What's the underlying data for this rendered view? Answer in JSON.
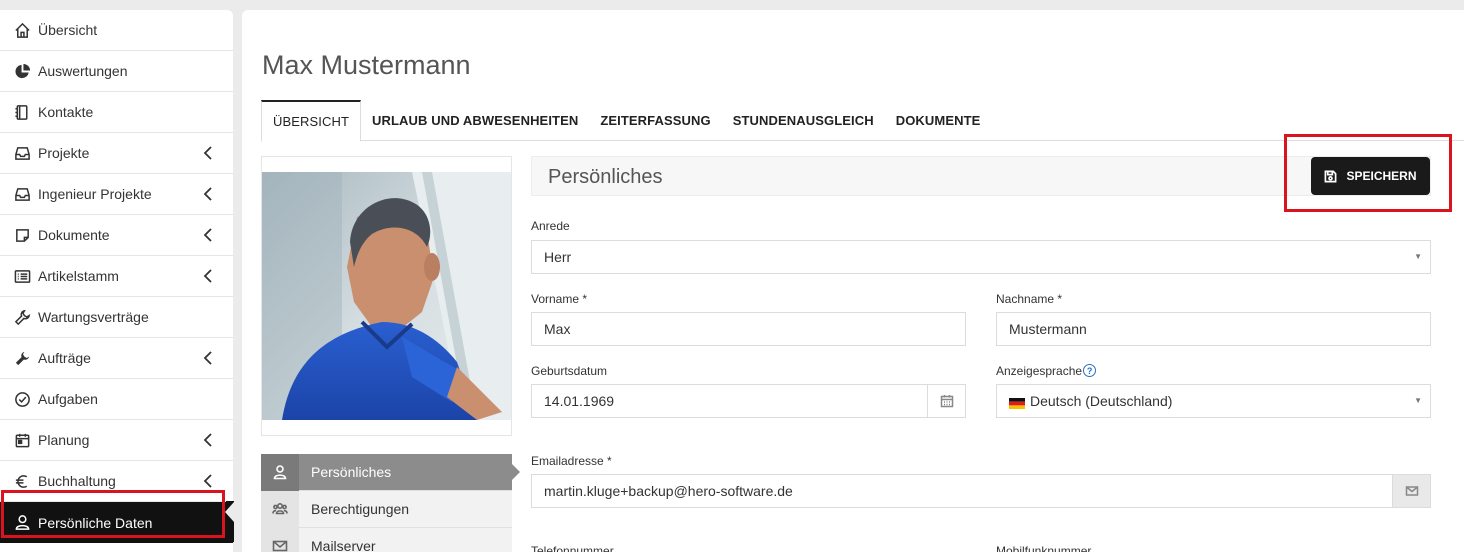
{
  "sidebar": {
    "items": [
      {
        "label": "Übersicht",
        "icon": "home-icon",
        "has_submenu": false
      },
      {
        "label": "Auswertungen",
        "icon": "pie-chart-icon",
        "has_submenu": false
      },
      {
        "label": "Kontakte",
        "icon": "address-book-icon",
        "has_submenu": false
      },
      {
        "label": "Projekte",
        "icon": "inbox-icon",
        "has_submenu": true
      },
      {
        "label": "Ingenieur Projekte",
        "icon": "inbox-icon",
        "has_submenu": true
      },
      {
        "label": "Dokumente",
        "icon": "sticky-note-icon",
        "has_submenu": true
      },
      {
        "label": "Artikelstamm",
        "icon": "list-icon",
        "has_submenu": true
      },
      {
        "label": "Wartungsverträge",
        "icon": "wrench-icon",
        "has_submenu": false
      },
      {
        "label": "Aufträge",
        "icon": "wrench-icon",
        "has_submenu": true
      },
      {
        "label": "Aufgaben",
        "icon": "check-circle-icon",
        "has_submenu": false
      },
      {
        "label": "Planung",
        "icon": "calendar-icon",
        "has_submenu": true
      },
      {
        "label": "Buchhaltung",
        "icon": "euro-icon",
        "has_submenu": true
      },
      {
        "label": "Persönliche Daten",
        "icon": "user-icon",
        "has_submenu": false,
        "active": true
      }
    ]
  },
  "page": {
    "title": "Max Mustermann"
  },
  "tabs": [
    {
      "label": "ÜBERSICHT",
      "active": true
    },
    {
      "label": "URLAUB UND ABWESENHEITEN"
    },
    {
      "label": "ZEITERFASSUNG"
    },
    {
      "label": "STUNDENAUSGLEICH"
    },
    {
      "label": "DOKUMENTE"
    }
  ],
  "sub_menu": [
    {
      "label": "Persönliches",
      "icon": "user-icon",
      "active": true
    },
    {
      "label": "Berechtigungen",
      "icon": "users-icon"
    },
    {
      "label": "Mailserver",
      "icon": "envelope-icon"
    }
  ],
  "section": {
    "title": "Persönliches",
    "save_label": "SPEICHERN"
  },
  "form": {
    "anrede_label": "Anrede",
    "anrede_value": "Herr",
    "vorname_label": "Vorname *",
    "vorname_value": "Max",
    "nachname_label": "Nachname *",
    "nachname_value": "Mustermann",
    "geburtsdatum_label": "Geburtsdatum",
    "geburtsdatum_value": "14.01.1969",
    "sprache_label": "Anzeigesprache",
    "sprache_value": "Deutsch (Deutschland)",
    "email_label": "Emailadresse *",
    "email_value": "martin.kluge+backup@hero-software.de",
    "telefon_label": "Telefonnummer",
    "mobil_label": "Mobilfunknummer"
  },
  "colors": {
    "highlight": "#d9141f",
    "active_nav": "#111111",
    "active_sub": "#8c8c8c"
  }
}
